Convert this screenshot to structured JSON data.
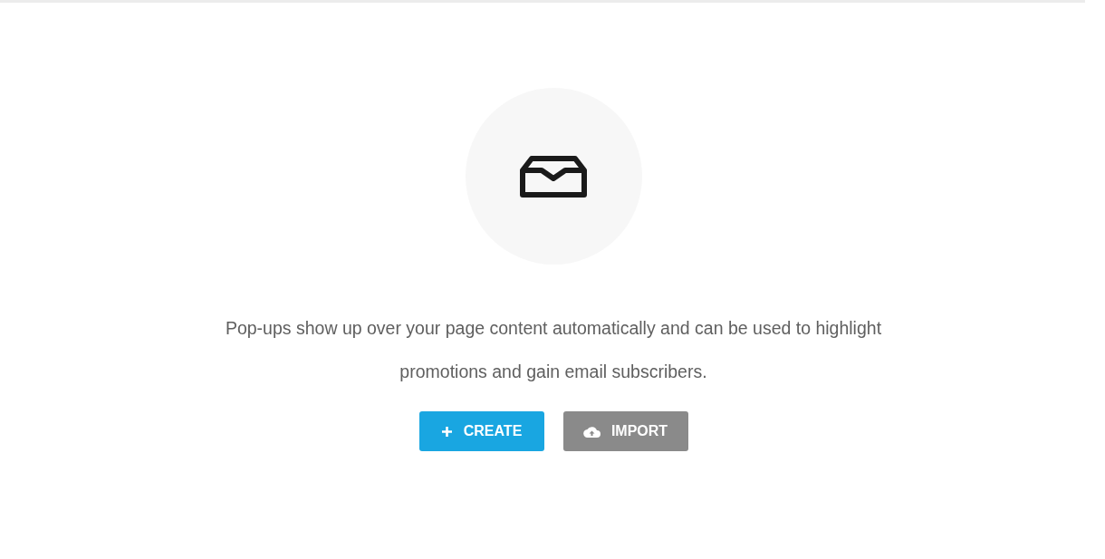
{
  "empty_state": {
    "description": "Pop-ups show up over your page content automatically and can be used to highlight promotions and gain email subscribers.",
    "buttons": [
      {
        "label": "CREATE",
        "kind": "primary"
      },
      {
        "label": "IMPORT",
        "kind": "secondary"
      }
    ]
  }
}
